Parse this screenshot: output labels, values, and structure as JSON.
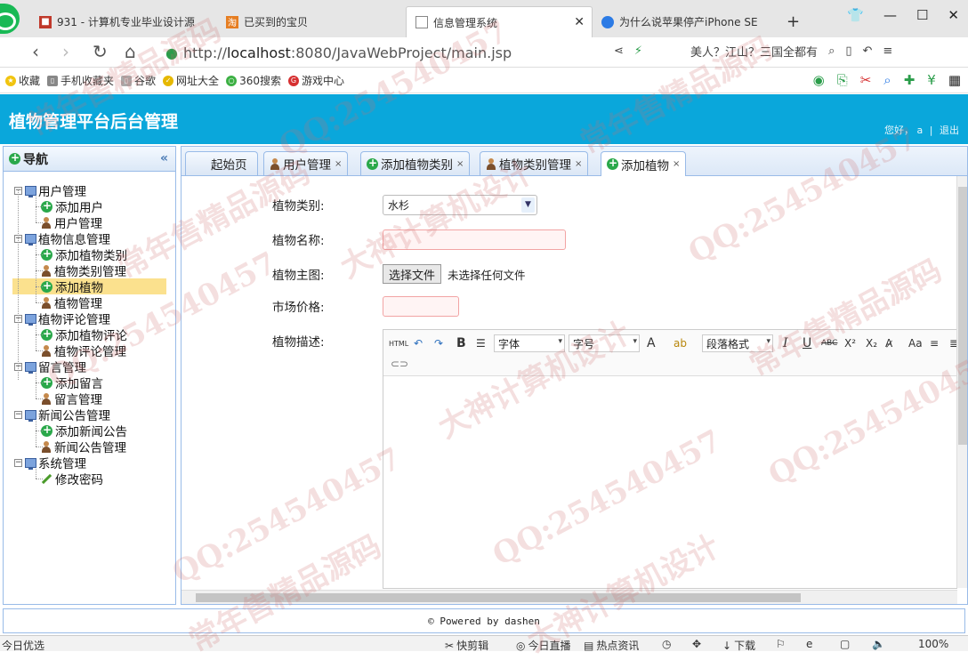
{
  "browser": {
    "tabs": [
      {
        "label": "931 - 计算机专业毕业设计源"
      },
      {
        "label": "已买到的宝贝"
      },
      {
        "label": "信息管理系统"
      },
      {
        "label": "为什么说苹果停产iPhone SE"
      }
    ],
    "url_prefix": "http://",
    "url_host": "localhost",
    "url_path": ":8080/JavaWebProject/main.jsp",
    "news_ticker": "美人？江山？三国全都有",
    "bookmarks": [
      "收藏",
      "手机收藏夹",
      "谷歌",
      "网址大全",
      "360搜索",
      "游戏中心"
    ]
  },
  "app": {
    "title": "植物管理平台后台管理",
    "greeting": "您好，",
    "user": "a",
    "sep": "|",
    "logout": "退出"
  },
  "sidebar": {
    "title": "导航",
    "collapse": "«",
    "groups": [
      {
        "label": "用户管理",
        "items": [
          "添加用户",
          "用户管理"
        ]
      },
      {
        "label": "植物信息管理",
        "items": [
          "添加植物类别",
          "植物类别管理",
          "添加植物",
          "植物管理"
        ]
      },
      {
        "label": "植物评论管理",
        "items": [
          "添加植物评论",
          "植物评论管理"
        ]
      },
      {
        "label": "留言管理",
        "items": [
          "添加留言",
          "留言管理"
        ]
      },
      {
        "label": "新闻公告管理",
        "items": [
          "添加新闻公告",
          "新闻公告管理"
        ]
      },
      {
        "label": "系统管理",
        "items": [
          "修改密码"
        ]
      }
    ],
    "selected": "添加植物"
  },
  "tabs": [
    {
      "label": "起始页"
    },
    {
      "label": "用户管理",
      "close": "×"
    },
    {
      "label": "添加植物类别",
      "close": "×"
    },
    {
      "label": "植物类别管理",
      "close": "×"
    },
    {
      "label": "添加植物",
      "close": "×"
    }
  ],
  "form": {
    "type_label": "植物类别:",
    "type_value": "水杉",
    "name_label": "植物名称:",
    "name_value": "",
    "image_label": "植物主图:",
    "file_button": "选择文件",
    "file_status": "未选择任何文件",
    "price_label": "市场价格:",
    "price_value": "",
    "desc_label": "植物描述:"
  },
  "editor_toolbar": {
    "html": "HTML",
    "bold": "B",
    "italic": "I",
    "underline": "U",
    "strike": "ABC",
    "sup": "X²",
    "sub": "X₂",
    "font": "字体",
    "size": "字号",
    "format": "段落格式",
    "fontcolor": "A",
    "bgcolor": "ab"
  },
  "footer": {
    "text": "© Powered by dashen"
  },
  "statusbar": {
    "left": "今日优选",
    "items": [
      "快剪辑",
      "今日直播",
      "热点资讯",
      "下载"
    ],
    "zoom": "100%"
  },
  "watermarks": [
    "QQ:254540457",
    "大神计算机设计",
    "常年售精品源码"
  ],
  "colors": {
    "header": "#0aa7db",
    "selected": "#fbe18e",
    "panel_border": "#99bbe8"
  }
}
